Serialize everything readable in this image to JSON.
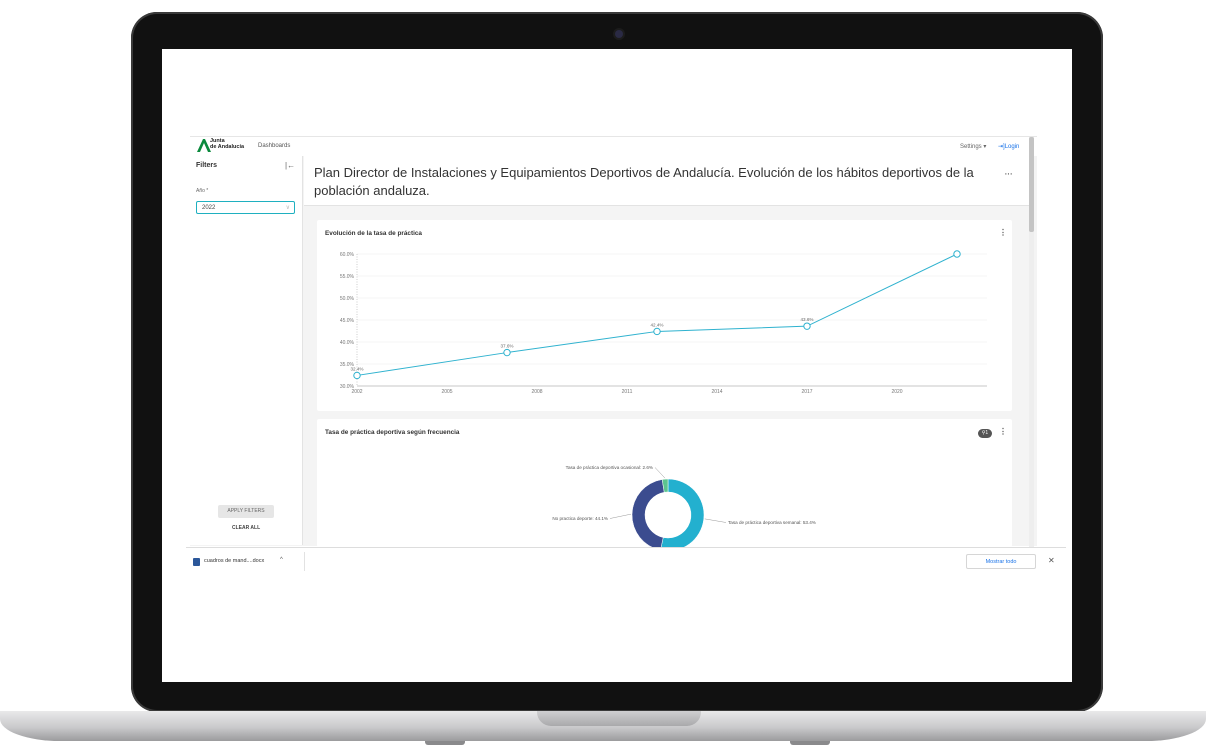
{
  "app": {
    "logo_line1": "Junta",
    "logo_line2": "de Andalucía",
    "nav_dashboards": "Dashboards",
    "settings": "Settings ▾",
    "login": "⇥]Login"
  },
  "sidebar": {
    "title": "Filters",
    "collapse_icon": "|←",
    "year_label": "Año *",
    "year_value": "2022",
    "apply_label": "APPLY FILTERS",
    "clear_label": "CLEAR ALL"
  },
  "header": {
    "title": "Plan Director de Instalaciones y Equipamientos Deportivos de Andalucía. Evolución de los hábitos deportivos de la población andaluza.",
    "menu": "···"
  },
  "cards": {
    "line_title": "Evolución de la tasa de práctica",
    "pie_title": "Tasa de práctica deportiva según frecuencia",
    "filter_badge": "⚲1",
    "kebab": "⋮"
  },
  "chart_data": [
    {
      "type": "line",
      "title": "Evolución de la tasa de práctica",
      "x": [
        2002,
        2007,
        2012,
        2017,
        2022
      ],
      "series": [
        {
          "values": [
            32.4,
            37.6,
            42.4,
            43.6,
            60.0
          ]
        }
      ],
      "data_labels": [
        "32.4%",
        "37.6%",
        "42.4%",
        "43.6%",
        ""
      ],
      "x_ticks": [
        "2002",
        "2005",
        "2008",
        "2011",
        "2014",
        "2017",
        "2020"
      ],
      "y_ticks": [
        "30.0%",
        "35.0%",
        "40.0%",
        "45.0%",
        "50.0%",
        "55.0%",
        "60.0%"
      ],
      "ylim": [
        30,
        60
      ],
      "xlim": [
        2002,
        2023
      ],
      "color": "#2fb2cf",
      "grid": true
    },
    {
      "type": "pie",
      "title": "Tasa de práctica deportiva según frecuencia",
      "categories": [
        "Tasa de práctica deportiva semanal",
        "No practica deporte",
        "Tasa de práctica deportiva ocasional"
      ],
      "values": [
        53.4,
        44.1,
        2.6
      ],
      "labels": [
        "Tasa de práctica deportiva semanal: 53.4%",
        "No practica deporte: 44.1%",
        "Tasa de práctica deportiva ocasional: 2.6%"
      ],
      "colors": [
        "#23b0cf",
        "#3b4c8f",
        "#5cc48f"
      ]
    }
  ],
  "download_bar": {
    "file_name": "cuadros de mand....docx",
    "chevron": "^",
    "show_all": "Mostrar todo",
    "close": "✕"
  }
}
